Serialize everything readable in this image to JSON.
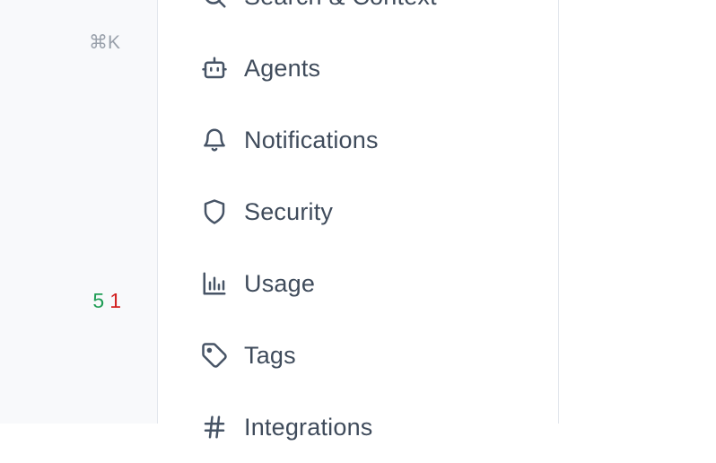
{
  "sidebar": {
    "shortcut": "⌘K",
    "diff": {
      "added": "5",
      "removed": "1"
    }
  },
  "menu": {
    "items": [
      {
        "label": "Search & Context",
        "icon": "search-icon"
      },
      {
        "label": "Agents",
        "icon": "robot-icon"
      },
      {
        "label": "Notifications",
        "icon": "bell-icon"
      },
      {
        "label": "Security",
        "icon": "shield-icon"
      },
      {
        "label": "Usage",
        "icon": "bar-chart-icon"
      },
      {
        "label": "Tags",
        "icon": "tag-icon"
      },
      {
        "label": "Integrations",
        "icon": "hash-icon"
      }
    ]
  },
  "colors": {
    "icon": "#475466",
    "label": "#3f4b5b",
    "muted": "#9aa1ab",
    "added": "#1f9d55",
    "removed": "#d21f1f",
    "border": "#e2e6ec",
    "sidebar_bg": "#f8f9fb"
  }
}
